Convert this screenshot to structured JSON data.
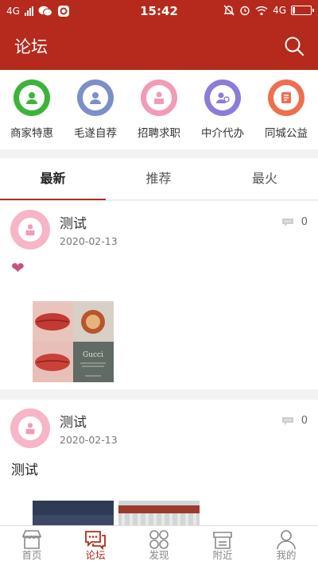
{
  "status_bar": {
    "network_left": "4G",
    "time": "15:42",
    "network_right": "4G"
  },
  "header": {
    "title": "论坛",
    "search_icon": "search-icon"
  },
  "categories": [
    {
      "label": "商家特惠",
      "color": "#3db33a",
      "icon": "merchant-icon"
    },
    {
      "label": "毛遂自荐",
      "color": "#7b8fc9",
      "icon": "user-recommend-icon"
    },
    {
      "label": "招聘求职",
      "color": "#f29bb3",
      "icon": "job-icon"
    },
    {
      "label": "中介代办",
      "color": "#8a7cd8",
      "icon": "agency-icon"
    },
    {
      "label": "同城公益",
      "color": "#ee6e4f",
      "icon": "charity-icon"
    }
  ],
  "tabs": [
    {
      "label": "最新",
      "active": true
    },
    {
      "label": "推荐",
      "active": false
    },
    {
      "label": "最火",
      "active": false
    }
  ],
  "posts": [
    {
      "author": "测试",
      "date": "2020-02-13",
      "comments": "0",
      "content_icon": "heart-icon"
    },
    {
      "author": "测试",
      "date": "2020-02-13",
      "comments": "0",
      "content": "测试"
    }
  ],
  "thumb_text": {
    "brand": "Gucci"
  },
  "bottom_nav": [
    {
      "label": "首页",
      "icon": "home-store-icon",
      "active": false
    },
    {
      "label": "论坛",
      "icon": "forum-chat-icon",
      "active": true
    },
    {
      "label": "发现",
      "icon": "discover-grid-icon",
      "active": false
    },
    {
      "label": "附近",
      "icon": "nearby-shop-icon",
      "active": false
    },
    {
      "label": "我的",
      "icon": "profile-icon",
      "active": false
    }
  ],
  "colors": {
    "brand": "#b52a1c",
    "background": "#f2f2f2",
    "avatar_pink": "#f7b5c8"
  }
}
